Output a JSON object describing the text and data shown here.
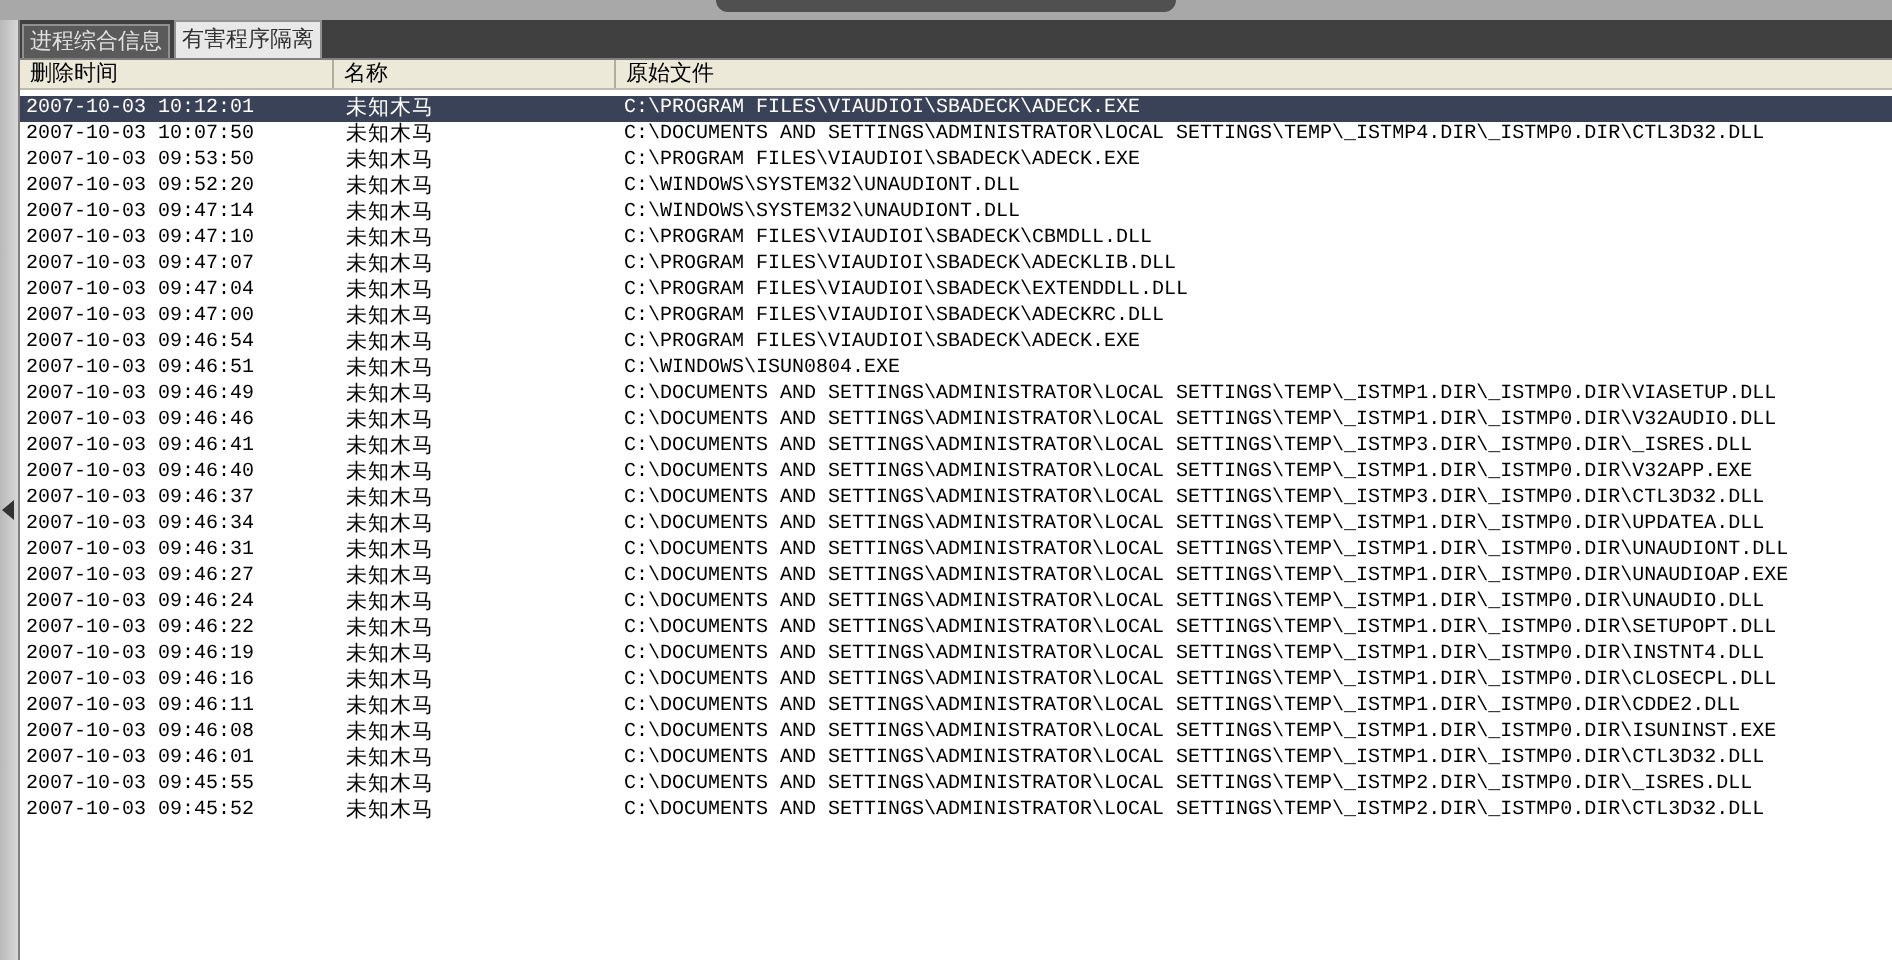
{
  "tabs": [
    {
      "label": "进程综合信息",
      "selected": false
    },
    {
      "label": "有害程序隔离",
      "selected": true
    }
  ],
  "table": {
    "columns": [
      "删除时间",
      "名称",
      "原始文件"
    ],
    "rows": [
      {
        "time": "2007-10-03 10:12:01",
        "name": "未知木马",
        "path": "C:\\PROGRAM FILES\\VIAUDIOI\\SBADECK\\ADECK.EXE",
        "selected": true
      },
      {
        "time": "2007-10-03 10:07:50",
        "name": "未知木马",
        "path": "C:\\DOCUMENTS AND SETTINGS\\ADMINISTRATOR\\LOCAL SETTINGS\\TEMP\\_ISTMP4.DIR\\_ISTMP0.DIR\\CTL3D32.DLL",
        "selected": false
      },
      {
        "time": "2007-10-03 09:53:50",
        "name": "未知木马",
        "path": "C:\\PROGRAM FILES\\VIAUDIOI\\SBADECK\\ADECK.EXE",
        "selected": false
      },
      {
        "time": "2007-10-03 09:52:20",
        "name": "未知木马",
        "path": "C:\\WINDOWS\\SYSTEM32\\UNAUDIONT.DLL",
        "selected": false
      },
      {
        "time": "2007-10-03 09:47:14",
        "name": "未知木马",
        "path": "C:\\WINDOWS\\SYSTEM32\\UNAUDIONT.DLL",
        "selected": false
      },
      {
        "time": "2007-10-03 09:47:10",
        "name": "未知木马",
        "path": "C:\\PROGRAM FILES\\VIAUDIOI\\SBADECK\\CBMDLL.DLL",
        "selected": false
      },
      {
        "time": "2007-10-03 09:47:07",
        "name": "未知木马",
        "path": "C:\\PROGRAM FILES\\VIAUDIOI\\SBADECK\\ADECKLIB.DLL",
        "selected": false
      },
      {
        "time": "2007-10-03 09:47:04",
        "name": "未知木马",
        "path": "C:\\PROGRAM FILES\\VIAUDIOI\\SBADECK\\EXTENDDLL.DLL",
        "selected": false
      },
      {
        "time": "2007-10-03 09:47:00",
        "name": "未知木马",
        "path": "C:\\PROGRAM FILES\\VIAUDIOI\\SBADECK\\ADECKRC.DLL",
        "selected": false
      },
      {
        "time": "2007-10-03 09:46:54",
        "name": "未知木马",
        "path": "C:\\PROGRAM FILES\\VIAUDIOI\\SBADECK\\ADECK.EXE",
        "selected": false
      },
      {
        "time": "2007-10-03 09:46:51",
        "name": "未知木马",
        "path": "C:\\WINDOWS\\ISUN0804.EXE",
        "selected": false
      },
      {
        "time": "2007-10-03 09:46:49",
        "name": "未知木马",
        "path": "C:\\DOCUMENTS AND SETTINGS\\ADMINISTRATOR\\LOCAL SETTINGS\\TEMP\\_ISTMP1.DIR\\_ISTMP0.DIR\\VIASETUP.DLL",
        "selected": false
      },
      {
        "time": "2007-10-03 09:46:46",
        "name": "未知木马",
        "path": "C:\\DOCUMENTS AND SETTINGS\\ADMINISTRATOR\\LOCAL SETTINGS\\TEMP\\_ISTMP1.DIR\\_ISTMP0.DIR\\V32AUDIO.DLL",
        "selected": false
      },
      {
        "time": "2007-10-03 09:46:41",
        "name": "未知木马",
        "path": "C:\\DOCUMENTS AND SETTINGS\\ADMINISTRATOR\\LOCAL SETTINGS\\TEMP\\_ISTMP3.DIR\\_ISTMP0.DIR\\_ISRES.DLL",
        "selected": false
      },
      {
        "time": "2007-10-03 09:46:40",
        "name": "未知木马",
        "path": "C:\\DOCUMENTS AND SETTINGS\\ADMINISTRATOR\\LOCAL SETTINGS\\TEMP\\_ISTMP1.DIR\\_ISTMP0.DIR\\V32APP.EXE",
        "selected": false
      },
      {
        "time": "2007-10-03 09:46:37",
        "name": "未知木马",
        "path": "C:\\DOCUMENTS AND SETTINGS\\ADMINISTRATOR\\LOCAL SETTINGS\\TEMP\\_ISTMP3.DIR\\_ISTMP0.DIR\\CTL3D32.DLL",
        "selected": false
      },
      {
        "time": "2007-10-03 09:46:34",
        "name": "未知木马",
        "path": "C:\\DOCUMENTS AND SETTINGS\\ADMINISTRATOR\\LOCAL SETTINGS\\TEMP\\_ISTMP1.DIR\\_ISTMP0.DIR\\UPDATEA.DLL",
        "selected": false
      },
      {
        "time": "2007-10-03 09:46:31",
        "name": "未知木马",
        "path": "C:\\DOCUMENTS AND SETTINGS\\ADMINISTRATOR\\LOCAL SETTINGS\\TEMP\\_ISTMP1.DIR\\_ISTMP0.DIR\\UNAUDIONT.DLL",
        "selected": false
      },
      {
        "time": "2007-10-03 09:46:27",
        "name": "未知木马",
        "path": "C:\\DOCUMENTS AND SETTINGS\\ADMINISTRATOR\\LOCAL SETTINGS\\TEMP\\_ISTMP1.DIR\\_ISTMP0.DIR\\UNAUDIOAP.EXE",
        "selected": false
      },
      {
        "time": "2007-10-03 09:46:24",
        "name": "未知木马",
        "path": "C:\\DOCUMENTS AND SETTINGS\\ADMINISTRATOR\\LOCAL SETTINGS\\TEMP\\_ISTMP1.DIR\\_ISTMP0.DIR\\UNAUDIO.DLL",
        "selected": false
      },
      {
        "time": "2007-10-03 09:46:22",
        "name": "未知木马",
        "path": "C:\\DOCUMENTS AND SETTINGS\\ADMINISTRATOR\\LOCAL SETTINGS\\TEMP\\_ISTMP1.DIR\\_ISTMP0.DIR\\SETUPOPT.DLL",
        "selected": false
      },
      {
        "time": "2007-10-03 09:46:19",
        "name": "未知木马",
        "path": "C:\\DOCUMENTS AND SETTINGS\\ADMINISTRATOR\\LOCAL SETTINGS\\TEMP\\_ISTMP1.DIR\\_ISTMP0.DIR\\INSTNT4.DLL",
        "selected": false
      },
      {
        "time": "2007-10-03 09:46:16",
        "name": "未知木马",
        "path": "C:\\DOCUMENTS AND SETTINGS\\ADMINISTRATOR\\LOCAL SETTINGS\\TEMP\\_ISTMP1.DIR\\_ISTMP0.DIR\\CLOSECPL.DLL",
        "selected": false
      },
      {
        "time": "2007-10-03 09:46:11",
        "name": "未知木马",
        "path": "C:\\DOCUMENTS AND SETTINGS\\ADMINISTRATOR\\LOCAL SETTINGS\\TEMP\\_ISTMP1.DIR\\_ISTMP0.DIR\\CDDE2.DLL",
        "selected": false
      },
      {
        "time": "2007-10-03 09:46:08",
        "name": "未知木马",
        "path": "C:\\DOCUMENTS AND SETTINGS\\ADMINISTRATOR\\LOCAL SETTINGS\\TEMP\\_ISTMP1.DIR\\_ISTMP0.DIR\\ISUNINST.EXE",
        "selected": false
      },
      {
        "time": "2007-10-03 09:46:01",
        "name": "未知木马",
        "path": "C:\\DOCUMENTS AND SETTINGS\\ADMINISTRATOR\\LOCAL SETTINGS\\TEMP\\_ISTMP1.DIR\\_ISTMP0.DIR\\CTL3D32.DLL",
        "selected": false
      },
      {
        "time": "2007-10-03 09:45:55",
        "name": "未知木马",
        "path": "C:\\DOCUMENTS AND SETTINGS\\ADMINISTRATOR\\LOCAL SETTINGS\\TEMP\\_ISTMP2.DIR\\_ISTMP0.DIR\\_ISRES.DLL",
        "selected": false
      },
      {
        "time": "2007-10-03 09:45:52",
        "name": "未知木马",
        "path": "C:\\DOCUMENTS AND SETTINGS\\ADMINISTRATOR\\LOCAL SETTINGS\\TEMP\\_ISTMP2.DIR\\_ISTMP0.DIR\\CTL3D32.DLL",
        "selected": false
      }
    ]
  }
}
